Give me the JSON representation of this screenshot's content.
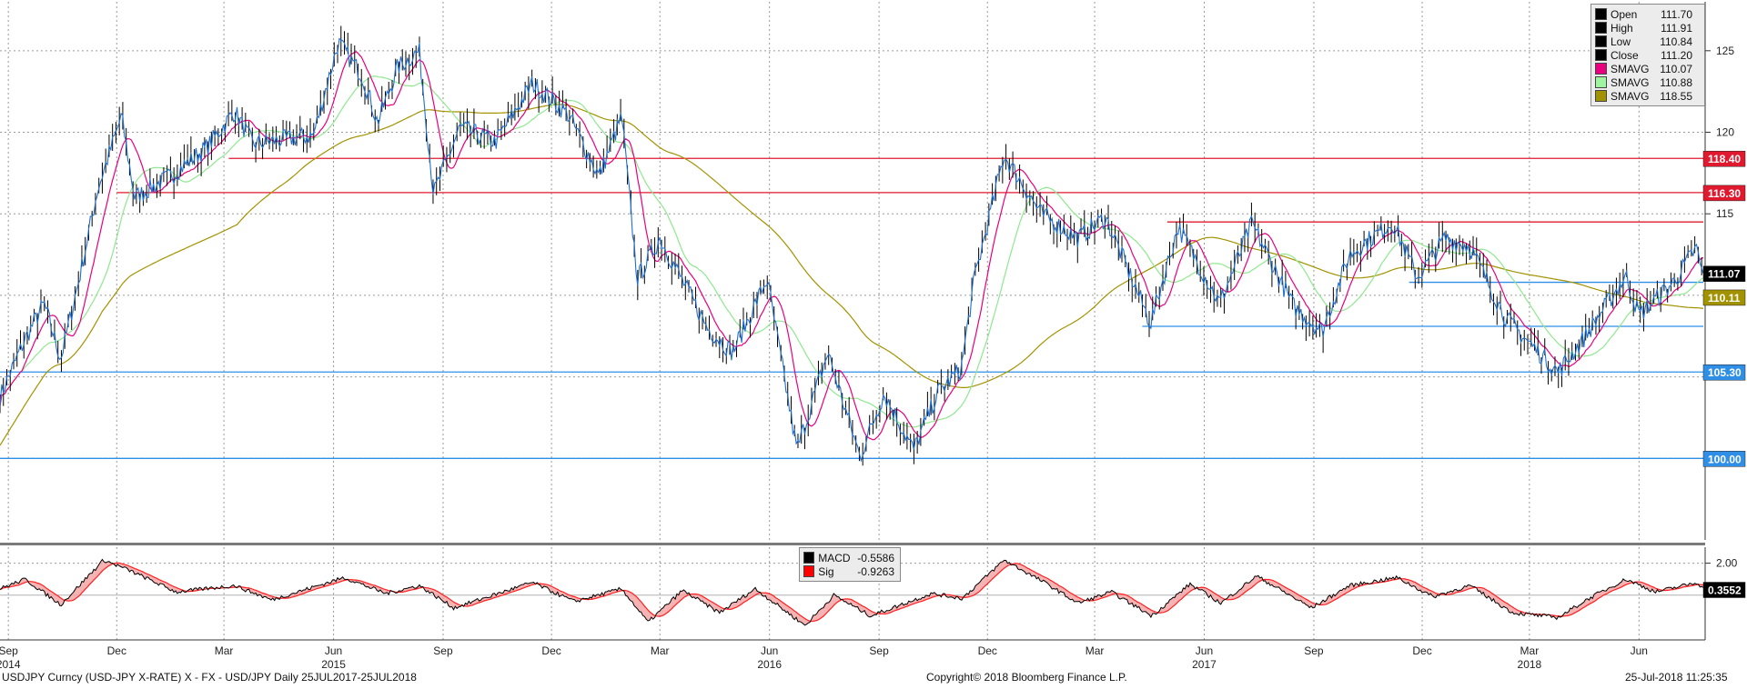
{
  "chart_data": [
    {
      "type": "line",
      "subtype": "candlestick_with_moving_averages",
      "instrument": "USDJPY",
      "ylim": [
        95,
        128
      ],
      "y_ticks": [
        100,
        105,
        110,
        115,
        120,
        125
      ],
      "x_range": [
        "2014-08-25",
        "2018-07-25"
      ],
      "month_ticks": [
        {
          "label": "Sep",
          "date": "2014-09-01"
        },
        {
          "label": "Dec",
          "date": "2014-12-01"
        },
        {
          "label": "Mar",
          "date": "2015-03-01"
        },
        {
          "label": "Jun",
          "date": "2015-06-01"
        },
        {
          "label": "Sep",
          "date": "2015-09-01"
        },
        {
          "label": "Dec",
          "date": "2015-12-01"
        },
        {
          "label": "Mar",
          "date": "2016-03-01"
        },
        {
          "label": "Jun",
          "date": "2016-06-01"
        },
        {
          "label": "Sep",
          "date": "2016-09-01"
        },
        {
          "label": "Dec",
          "date": "2016-12-01"
        },
        {
          "label": "Mar",
          "date": "2017-03-01"
        },
        {
          "label": "Jun",
          "date": "2017-06-01"
        },
        {
          "label": "Sep",
          "date": "2017-09-01"
        },
        {
          "label": "Dec",
          "date": "2017-12-01"
        },
        {
          "label": "Mar",
          "date": "2018-03-01"
        },
        {
          "label": "Jun",
          "date": "2018-06-01"
        }
      ],
      "year_ticks": [
        {
          "label": "2014",
          "date": "2014-09-01"
        },
        {
          "label": "2015",
          "date": "2015-06-01"
        },
        {
          "label": "2016",
          "date": "2016-06-01"
        },
        {
          "label": "2017",
          "date": "2017-06-01"
        },
        {
          "label": "2018",
          "date": "2018-03-01"
        }
      ],
      "price_path": [
        [
          "2014-08-25",
          103.8
        ],
        [
          "2014-09-15",
          107.3
        ],
        [
          "2014-10-01",
          109.5
        ],
        [
          "2014-10-15",
          106.1
        ],
        [
          "2014-10-31",
          111.2
        ],
        [
          "2014-11-15",
          116.5
        ],
        [
          "2014-12-05",
          121.0
        ],
        [
          "2014-12-16",
          116.0
        ],
        [
          "2015-01-15",
          117.3
        ],
        [
          "2015-02-15",
          119.1
        ],
        [
          "2015-03-10",
          121.3
        ],
        [
          "2015-03-25",
          119.3
        ],
        [
          "2015-04-15",
          119.5
        ],
        [
          "2015-05-15",
          119.8
        ],
        [
          "2015-06-05",
          125.5
        ],
        [
          "2015-06-25",
          123.5
        ],
        [
          "2015-07-08",
          120.6
        ],
        [
          "2015-07-25",
          124.0
        ],
        [
          "2015-08-12",
          125.0
        ],
        [
          "2015-08-24",
          116.2
        ],
        [
          "2015-09-15",
          120.3
        ],
        [
          "2015-10-15",
          119.4
        ],
        [
          "2015-11-15",
          123.0
        ],
        [
          "2015-12-15",
          121.1
        ],
        [
          "2016-01-10",
          117.3
        ],
        [
          "2016-01-29",
          121.0
        ],
        [
          "2016-02-11",
          111.0
        ],
        [
          "2016-03-01",
          113.5
        ],
        [
          "2016-04-10",
          108.0
        ],
        [
          "2016-05-01",
          106.5
        ],
        [
          "2016-05-30",
          111.0
        ],
        [
          "2016-06-24",
          100.5
        ],
        [
          "2016-07-20",
          106.5
        ],
        [
          "2016-08-16",
          100.1
        ],
        [
          "2016-09-05",
          104.0
        ],
        [
          "2016-09-30",
          100.5
        ],
        [
          "2016-10-20",
          104.0
        ],
        [
          "2016-11-09",
          105.5
        ],
        [
          "2016-11-20",
          111.0
        ],
        [
          "2016-12-15",
          118.6
        ],
        [
          "2017-01-15",
          115.0
        ],
        [
          "2017-02-15",
          113.5
        ],
        [
          "2017-03-10",
          114.8
        ],
        [
          "2017-04-17",
          108.3
        ],
        [
          "2017-05-10",
          114.2
        ],
        [
          "2017-06-14",
          109.5
        ],
        [
          "2017-07-11",
          114.4
        ],
        [
          "2017-08-15",
          109.3
        ],
        [
          "2017-09-08",
          107.8
        ],
        [
          "2017-10-01",
          112.5
        ],
        [
          "2017-11-06",
          114.5
        ],
        [
          "2017-11-27",
          111.1
        ],
        [
          "2017-12-20",
          113.5
        ],
        [
          "2018-01-10",
          113.0
        ],
        [
          "2018-02-10",
          108.5
        ],
        [
          "2018-03-25",
          105.3
        ],
        [
          "2018-04-15",
          107.3
        ],
        [
          "2018-05-21",
          111.2
        ],
        [
          "2018-06-01",
          108.8
        ],
        [
          "2018-06-30",
          110.8
        ],
        [
          "2018-07-19",
          112.9
        ],
        [
          "2018-07-25",
          111.1
        ]
      ],
      "horizontal_levels": [
        {
          "value": 118.4,
          "label": "118.40",
          "color": "#e0192f",
          "from": "2015-03-05"
        },
        {
          "value": 116.3,
          "label": "116.30",
          "color": "#e0192f",
          "from": "2014-12-01"
        },
        {
          "value": 114.5,
          "color": "#e0192f",
          "from": "2017-05-01"
        },
        {
          "value": 110.8,
          "color": "#2f8fe6",
          "from": "2017-11-20"
        },
        {
          "value": 108.1,
          "color": "#2f8fe6",
          "from": "2017-04-10"
        },
        {
          "value": 105.3,
          "label": "105.30",
          "color": "#2f8fe6",
          "from": "2014-08-25"
        },
        {
          "value": 100.0,
          "label": "100.00",
          "color": "#2f8fe6",
          "from": "2014-08-25"
        }
      ],
      "price_flags": [
        {
          "value": 111.07,
          "label": "111.07",
          "bg": "#000000"
        },
        {
          "value": 110.11,
          "label": "110.11",
          "bg": "#a39200"
        }
      ],
      "legend": [
        {
          "name": "Open",
          "value": "111.70",
          "color": "#000000"
        },
        {
          "name": "High",
          "value": "111.91",
          "color": "#000000"
        },
        {
          "name": "Low",
          "value": "110.84",
          "color": "#000000"
        },
        {
          "name": "Close",
          "value": "111.20",
          "color": "#000000"
        },
        {
          "name": "SMAVG",
          "value": "110.07",
          "color": "#e8007e"
        },
        {
          "name": "SMAVG",
          "value": "110.88",
          "color": "#9ff59f"
        },
        {
          "name": "SMAVG",
          "value": "118.55",
          "color": "#a39200"
        }
      ],
      "series_colors": {
        "price": "#1f6fd1",
        "sma_fast": "#e8007e",
        "sma_mid": "#8fe88f",
        "sma_slow": "#a39200"
      }
    },
    {
      "type": "line",
      "subtype": "macd",
      "y_ticks": [
        2.0
      ],
      "y_tick_labels": [
        "2.00"
      ],
      "zero_line": 0,
      "ylim": [
        -2.8,
        3.0
      ],
      "legend": [
        {
          "name": "MACD",
          "value": "-0.5586",
          "color": "#000000"
        },
        {
          "name": "Sig",
          "value": "-0.9263",
          "color": "#ff0000"
        }
      ],
      "last_value_flag": {
        "value": 0.3552,
        "label": "0.3552",
        "bg": "#000000"
      },
      "macd_path": [
        [
          "2014-08-25",
          0.4
        ],
        [
          "2014-09-15",
          1.0
        ],
        [
          "2014-10-15",
          -0.6
        ],
        [
          "2014-11-20",
          2.2
        ],
        [
          "2014-12-10",
          1.6
        ],
        [
          "2015-01-20",
          0.2
        ],
        [
          "2015-03-10",
          0.6
        ],
        [
          "2015-04-10",
          -0.3
        ],
        [
          "2015-06-10",
          1.1
        ],
        [
          "2015-07-15",
          0.1
        ],
        [
          "2015-08-12",
          0.6
        ],
        [
          "2015-09-10",
          -0.8
        ],
        [
          "2015-11-15",
          0.8
        ],
        [
          "2015-12-20",
          -0.4
        ],
        [
          "2016-01-29",
          0.4
        ],
        [
          "2016-02-20",
          -1.7
        ],
        [
          "2016-03-20",
          0.3
        ],
        [
          "2016-04-20",
          -1.1
        ],
        [
          "2016-05-20",
          0.4
        ],
        [
          "2016-07-01",
          -1.9
        ],
        [
          "2016-07-25",
          0.0
        ],
        [
          "2016-08-25",
          -1.3
        ],
        [
          "2016-10-15",
          0.1
        ],
        [
          "2016-11-10",
          -0.2
        ],
        [
          "2016-12-15",
          2.2
        ],
        [
          "2017-01-20",
          0.7
        ],
        [
          "2017-02-15",
          -0.5
        ],
        [
          "2017-03-15",
          0.2
        ],
        [
          "2017-04-18",
          -1.3
        ],
        [
          "2017-05-20",
          0.7
        ],
        [
          "2017-06-15",
          -0.5
        ],
        [
          "2017-07-15",
          1.2
        ],
        [
          "2017-08-30",
          -0.8
        ],
        [
          "2017-10-01",
          0.6
        ],
        [
          "2017-11-10",
          1.1
        ],
        [
          "2017-12-10",
          -0.1
        ],
        [
          "2018-01-10",
          0.6
        ],
        [
          "2018-02-15",
          -1.1
        ],
        [
          "2018-03-25",
          -1.4
        ],
        [
          "2018-04-20",
          -0.2
        ],
        [
          "2018-05-21",
          1.0
        ],
        [
          "2018-06-15",
          0.2
        ],
        [
          "2018-07-20",
          0.8
        ],
        [
          "2018-07-25",
          0.4
        ]
      ]
    }
  ],
  "footer": {
    "left": "USDJPY Curncy (USD-JPY X-RATE) X - FX - USD/JPY  Daily 25JUL2017-25JUL2018",
    "center": "Copyright© 2018 Bloomberg Finance L.P.",
    "right": "25-Jul-2018 11:25:35"
  }
}
